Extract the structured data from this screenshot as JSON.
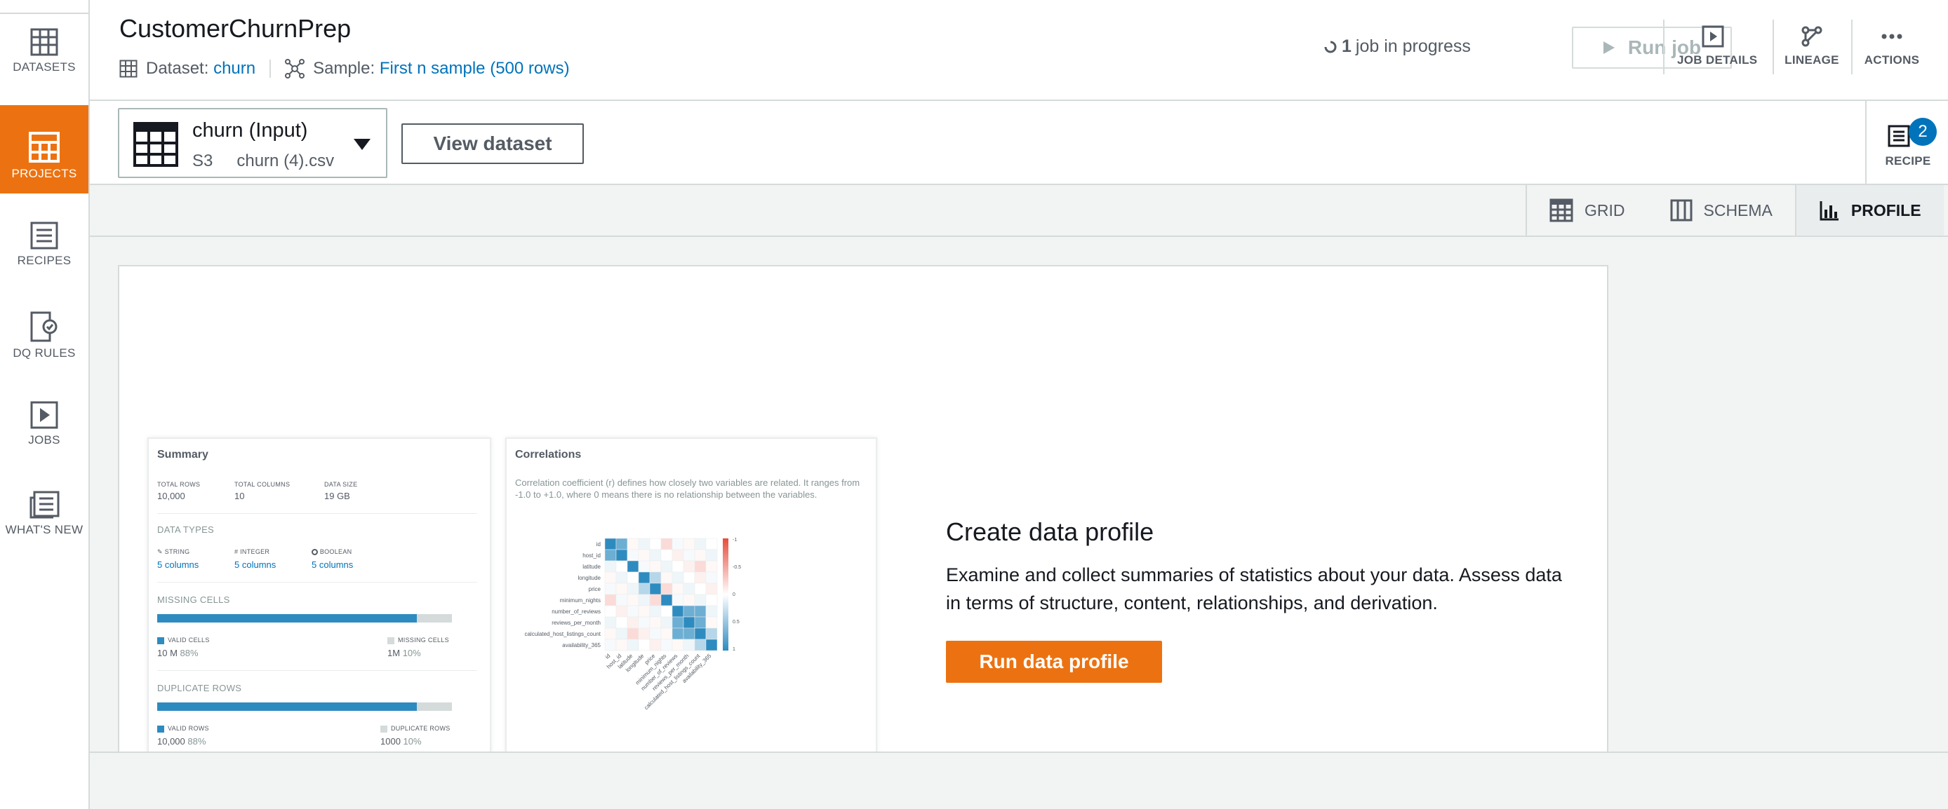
{
  "app": {
    "project_name": "CustomerChurnPrep"
  },
  "nav": {
    "items": [
      {
        "label": "DATASETS",
        "icon": "table-icon"
      },
      {
        "label": "PROJECTS",
        "icon": "project-grid-icon",
        "active": true
      },
      {
        "label": "RECIPES",
        "icon": "recipe-list-icon"
      },
      {
        "label": "DQ RULES",
        "icon": "dq-rules-icon"
      },
      {
        "label": "JOBS",
        "icon": "play-icon"
      },
      {
        "label": "WHAT'S NEW",
        "icon": "news-icon"
      }
    ]
  },
  "header": {
    "dataset_label": "Dataset:",
    "dataset_value": "churn",
    "sample_label": "Sample:",
    "sample_value": "First n sample (500 rows)",
    "job_count": "1",
    "job_status": "job in progress",
    "run_job_label": "Run job",
    "job_details_label": "JOB DETAILS",
    "lineage_label": "LINEAGE",
    "actions_label": "ACTIONS"
  },
  "toolbar": {
    "dataset_name": "churn (Input)",
    "dataset_source": "S3",
    "dataset_file": "churn (4).csv",
    "view_dataset_label": "View dataset",
    "recipe_label": "RECIPE",
    "recipe_count": "2"
  },
  "tabs": [
    {
      "label": "GRID",
      "icon": "grid-icon"
    },
    {
      "label": "SCHEMA",
      "icon": "schema-columns-icon"
    },
    {
      "label": "PROFILE",
      "icon": "profile-chart-icon",
      "active": true
    }
  ],
  "preview": {
    "summary": {
      "title": "Summary",
      "total_rows_label": "TOTAL ROWS",
      "total_rows": "10,000",
      "total_columns_label": "TOTAL COLUMNS",
      "total_columns": "10",
      "data_size_label": "DATA SIZE",
      "data_size": "19 GB",
      "data_types_label": "DATA TYPES",
      "string_label": "STRING",
      "string_count": "5 columns",
      "integer_label": "INTEGER",
      "integer_count": "5 columns",
      "boolean_label": "BOOLEAN",
      "boolean_count": "5 columns",
      "missing_label": "MISSING CELLS",
      "missing_fraction": 0.88,
      "valid_cells_label": "VALID CELLS",
      "valid_cells_value": "10 M",
      "valid_cells_pct": "88%",
      "missing_cells_label": "MISSING CELLS",
      "missing_cells_value": "1M",
      "missing_cells_pct": "10%",
      "duplicate_label": "DUPLICATE ROWS",
      "duplicate_fraction": 0.88,
      "valid_rows_label": "VALID ROWS",
      "valid_rows_value": "10,000",
      "valid_rows_pct": "88%",
      "duplicate_rows_label": "DUPLICATE ROWS",
      "duplicate_rows_value": "1000",
      "duplicate_rows_pct": "10%"
    },
    "correlations": {
      "title": "Correlations",
      "description": "Correlation coefficient (r) defines how closely two variables are related. It ranges from -1.0 to +1.0, where 0 means there is no relationship between the variables.",
      "variables": [
        "id",
        "host_id",
        "latitude",
        "longitude",
        "price",
        "minimum_nights",
        "number_of_reviews",
        "reviews_per_month",
        "calculated_host_listings_count",
        "availability_365"
      ],
      "scale_labels": [
        "-1",
        "-0.5",
        "0",
        "0.5",
        "1"
      ],
      "colors": {
        "negative": "#e74c3c",
        "positive": "#2e8bc0"
      }
    }
  },
  "profile_cta": {
    "title": "Create data profile",
    "description": "Examine and collect summaries of statistics about your data. Assess data in terms of structure, content, relationships, and derivation.",
    "button_label": "Run data profile"
  },
  "colors": {
    "accent": "#ec7211",
    "link": "#0073bb",
    "border": "#d5dbdb",
    "badge": "#0073bb"
  }
}
